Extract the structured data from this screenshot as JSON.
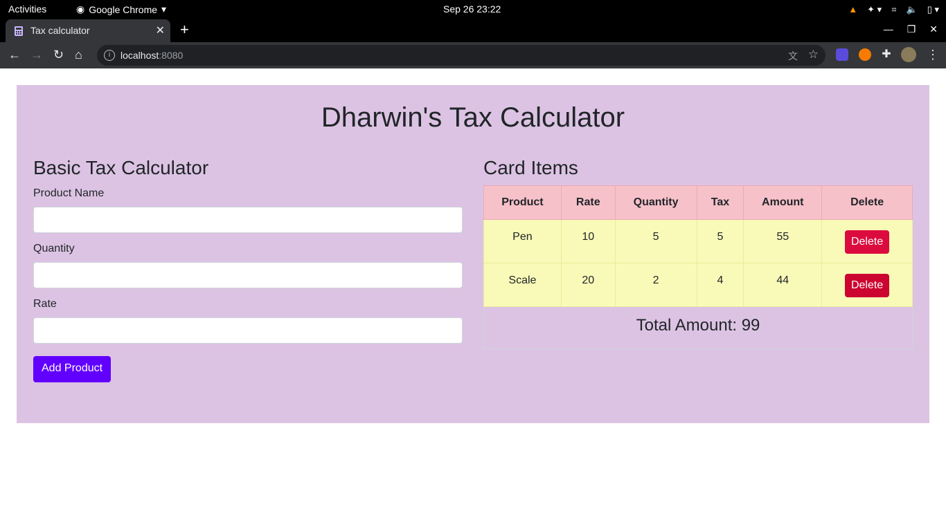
{
  "system_bar": {
    "activities": "Activities",
    "app_name": "Google Chrome",
    "clock": "Sep 26  23:22"
  },
  "browser": {
    "tab_title": "Tax calculator",
    "url_host": "localhost",
    "url_port": ":8080"
  },
  "page": {
    "heading": "Dharwin's Tax Calculator",
    "form": {
      "title": "Basic Tax Calculator",
      "product_name_label": "Product Name",
      "product_name_value": "",
      "quantity_label": "Quantity",
      "quantity_value": "",
      "rate_label": "Rate",
      "rate_value": "",
      "add_button": "Add Product"
    },
    "cart": {
      "title": "Card Items",
      "columns": [
        "Product",
        "Rate",
        "Quantity",
        "Tax",
        "Amount",
        "Delete"
      ],
      "rows": [
        {
          "product": "Pen",
          "rate": "10",
          "quantity": "5",
          "tax": "5",
          "amount": "55",
          "delete": "Delete"
        },
        {
          "product": "Scale",
          "rate": "20",
          "quantity": "2",
          "tax": "4",
          "amount": "44",
          "delete": "Delete"
        }
      ],
      "total": "Total Amount: 99"
    }
  },
  "colors": {
    "container_bg": "#dcc3e3",
    "header_row": "#f7c1ca",
    "body_row": "#f9f9b8",
    "add_button": "#6200ff",
    "delete_button": "#dc0b3e"
  }
}
